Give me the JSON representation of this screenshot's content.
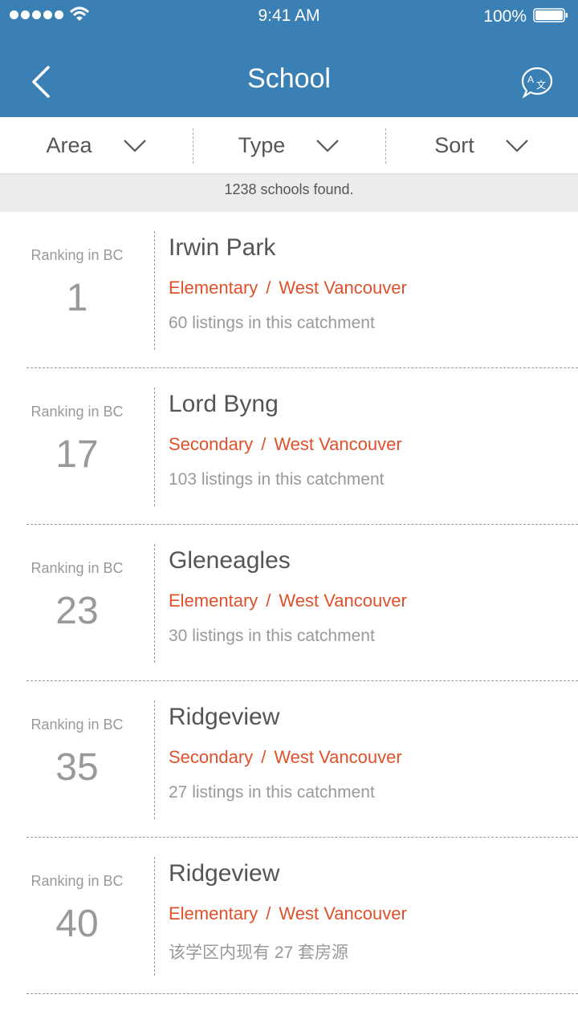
{
  "status_bar": {
    "time": "9:41 AM",
    "battery": "100%"
  },
  "header": {
    "title": "School"
  },
  "filters": [
    {
      "label": "Area"
    },
    {
      "label": "Type"
    },
    {
      "label": "Sort"
    }
  ],
  "results_text": "1238 schools found.",
  "schools": [
    {
      "rank_label": "Ranking in BC",
      "rank": "1",
      "name": "Irwin Park",
      "type": "Elementary",
      "separator": "/",
      "area": "West Vancouver",
      "listings": "60 listings in this catchment"
    },
    {
      "rank_label": "Ranking in BC",
      "rank": "17",
      "name": "Lord Byng",
      "type": "Secondary",
      "separator": "/",
      "area": "West Vancouver",
      "listings": "103 listings in this catchment"
    },
    {
      "rank_label": "Ranking in BC",
      "rank": "23",
      "name": "Gleneagles",
      "type": "Elementary",
      "separator": "/",
      "area": "West Vancouver",
      "listings": "30 listings in this catchment"
    },
    {
      "rank_label": "Ranking in BC",
      "rank": "35",
      "name": "Ridgeview",
      "type": "Secondary",
      "separator": "/",
      "area": "West Vancouver",
      "listings": "27 listings in this catchment"
    },
    {
      "rank_label": "Ranking in BC",
      "rank": "40",
      "name": "Ridgeview",
      "type": "Elementary",
      "separator": "/",
      "area": "West Vancouver",
      "listings": "该学区内现有 27 套房源"
    }
  ],
  "colors": {
    "header": "#3b80b5",
    "accent": "#e0502a",
    "muted": "#999999"
  },
  "icons": [
    "signal-icon",
    "wifi-icon",
    "battery-icon",
    "back-arrow-icon",
    "translate-icon",
    "chevron-down-icon"
  ]
}
